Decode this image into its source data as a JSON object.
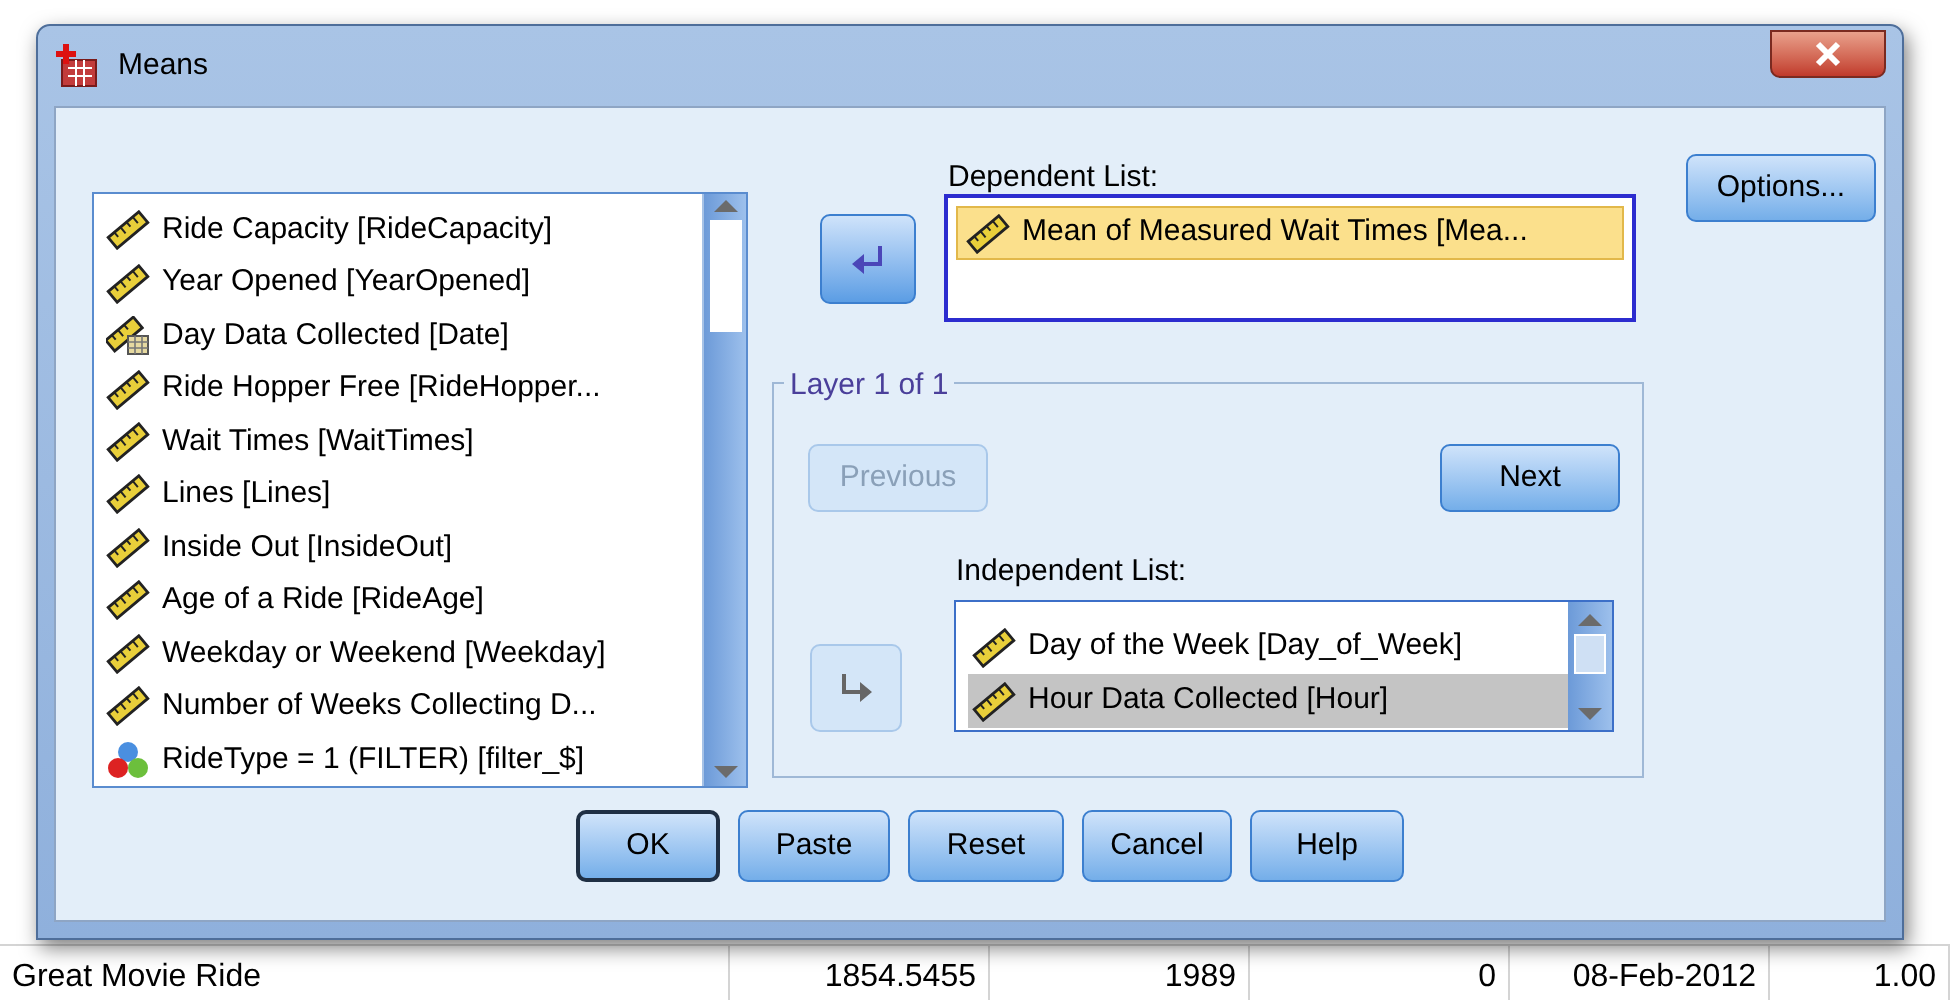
{
  "window": {
    "title": "Means"
  },
  "variables": [
    {
      "kind": "scale",
      "label": "Ride Capacity [RideCapacity]"
    },
    {
      "kind": "scale",
      "label": "Year Opened [YearOpened]"
    },
    {
      "kind": "date",
      "label": "Day Data Collected [Date]"
    },
    {
      "kind": "scale",
      "label": "Ride Hopper Free [RideHopper..."
    },
    {
      "kind": "scale",
      "label": "Wait Times [WaitTimes]"
    },
    {
      "kind": "scale",
      "label": "Lines [Lines]"
    },
    {
      "kind": "scale",
      "label": "Inside Out [InsideOut]"
    },
    {
      "kind": "scale",
      "label": "Age of a Ride [RideAge]"
    },
    {
      "kind": "scale",
      "label": "Weekday or Weekend [Weekday]"
    },
    {
      "kind": "scale",
      "label": "Number of Weeks Collecting D..."
    },
    {
      "kind": "filter",
      "label": "RideType = 1 (FILTER) [filter_$]"
    }
  ],
  "dependent_list": {
    "label": "Dependent List:",
    "items": [
      {
        "kind": "scale",
        "label": "Mean of Measured Wait Times [Mea...",
        "selected": true
      }
    ]
  },
  "move_buttons": [
    {
      "disabled": false
    },
    {
      "disabled": true
    }
  ],
  "options_button": "Options...",
  "layer": {
    "legend": "Layer 1 of 1",
    "buttons": [
      {
        "label": "Previous",
        "disabled": true
      },
      {
        "label": "Next",
        "disabled": false
      }
    ]
  },
  "independent_list": {
    "label": "Independent List:",
    "items": [
      {
        "kind": "scale",
        "label": "Day of the Week [Day_of_Week]",
        "selected": false
      },
      {
        "kind": "scale",
        "label": "Hour Data Collected [Hour]",
        "selected": true
      }
    ]
  },
  "buttons": [
    {
      "label": "OK",
      "default": true
    },
    {
      "label": "Paste",
      "default": false
    },
    {
      "label": "Reset",
      "default": false
    },
    {
      "label": "Cancel",
      "default": false
    },
    {
      "label": "Help",
      "default": false
    }
  ],
  "background_row": [
    "Great Movie Ride",
    "1854.5455",
    "1989",
    "0",
    "08-Feb-2012",
    "1.00"
  ]
}
